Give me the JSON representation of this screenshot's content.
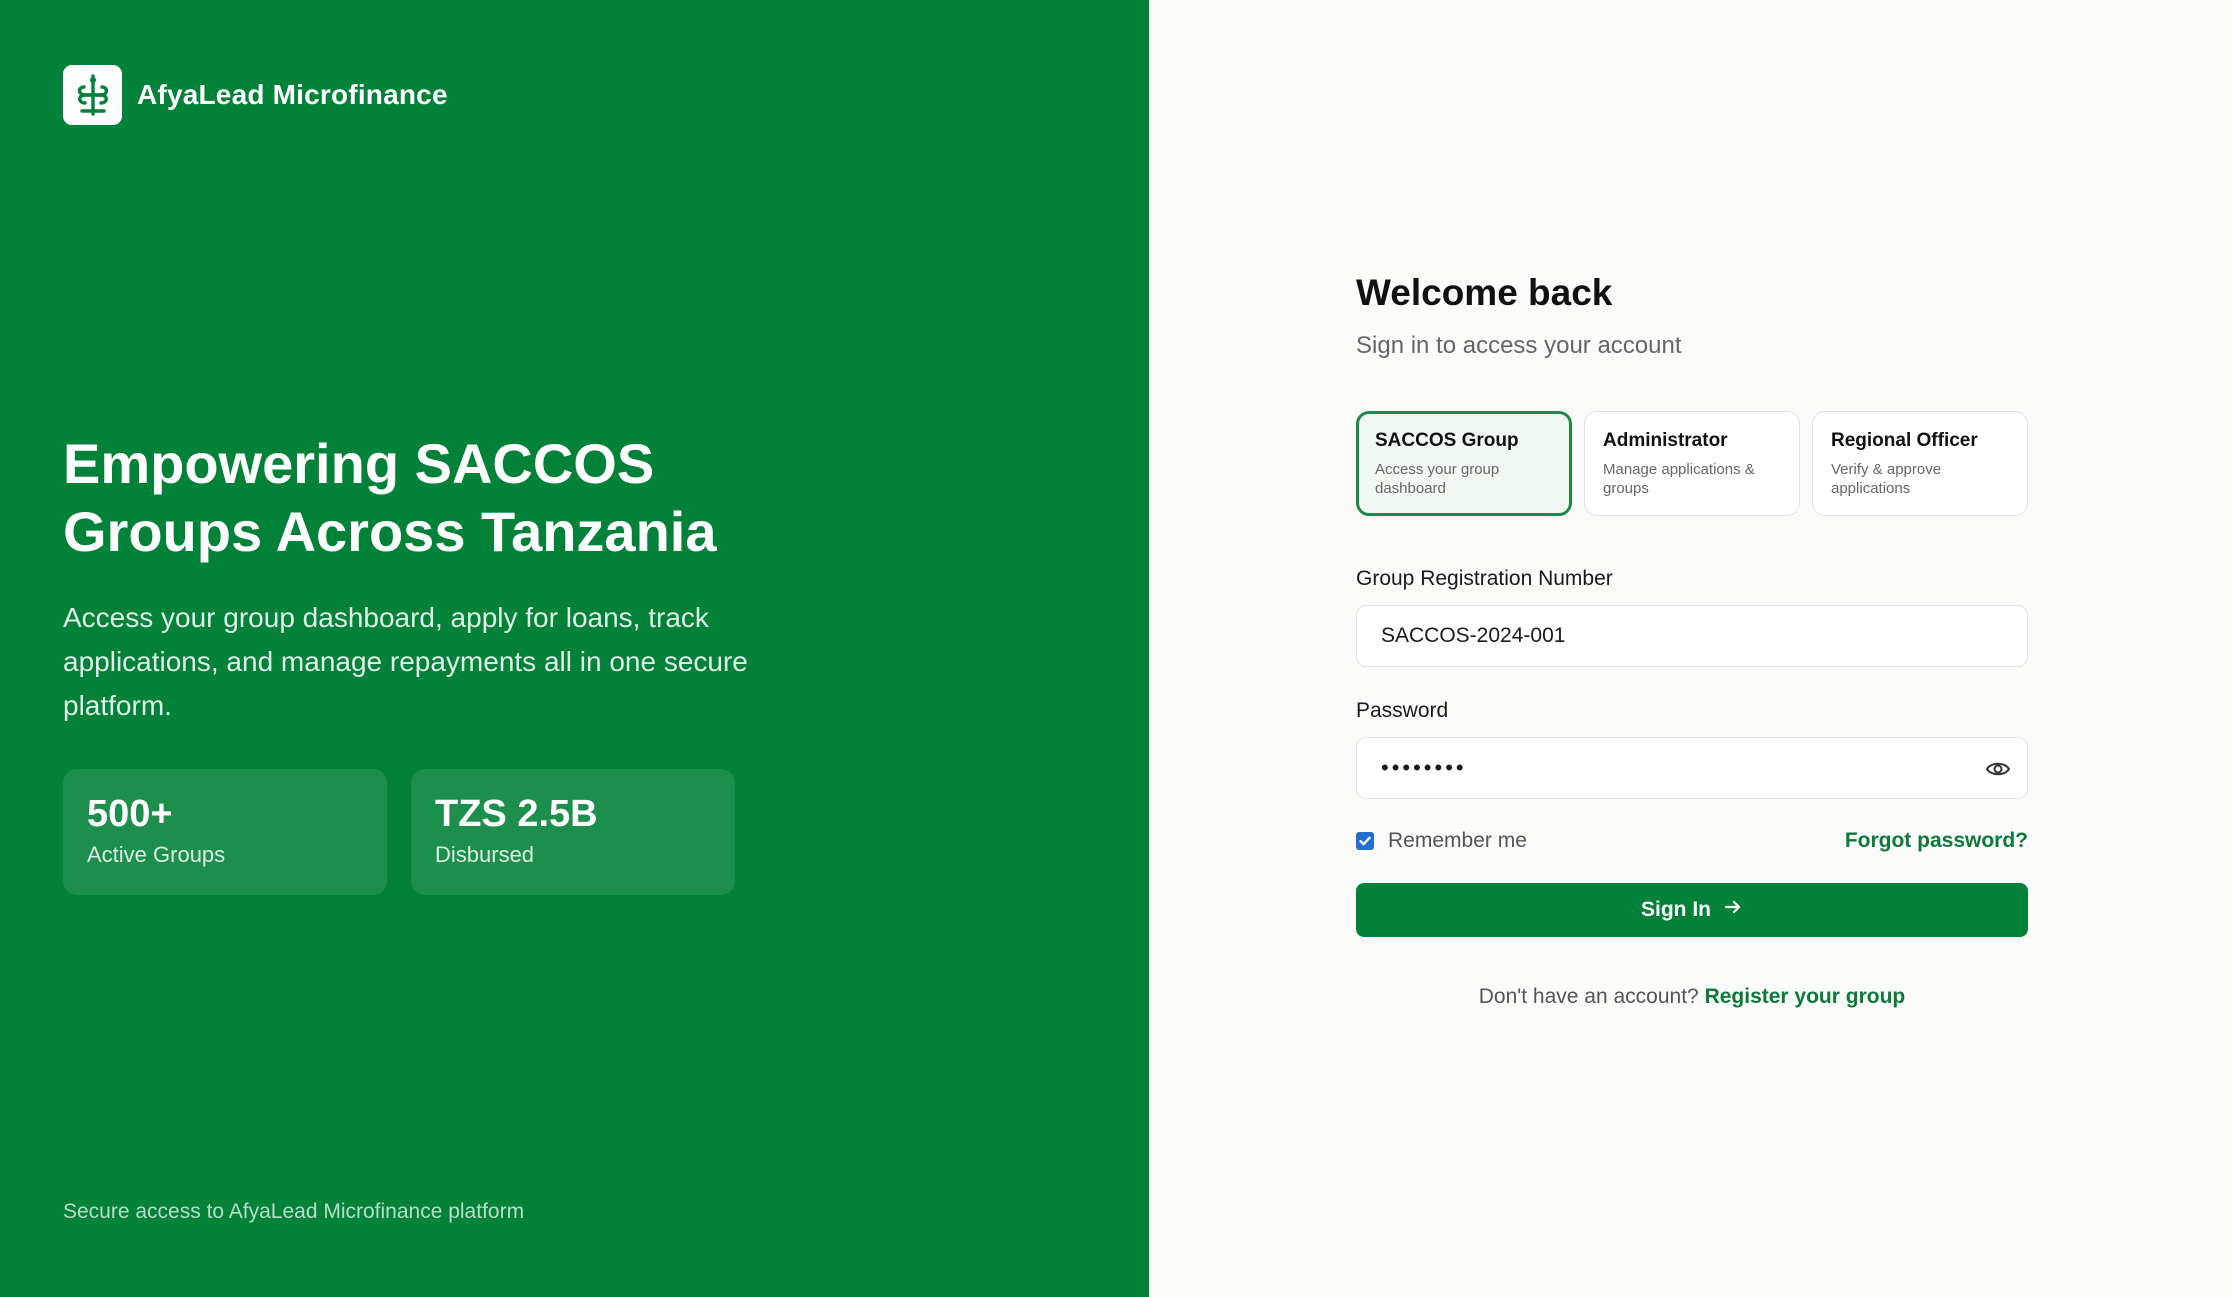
{
  "brand": {
    "name": "AfyaLead Microfinance",
    "logo_icon": "caduceus-icon",
    "accent": "#018238"
  },
  "hero": {
    "title": "Empowering SACCOS Groups Across Tanzania",
    "subtitle": "Access your group dashboard, apply for loans, track applications, and manage repayments all in one secure platform."
  },
  "stats": [
    {
      "value": "500+",
      "label": "Active Groups"
    },
    {
      "value": "TZS 2.5B",
      "label": "Disbursed"
    }
  ],
  "left_footer": "Secure access to AfyaLead Microfinance platform",
  "login": {
    "title": "Welcome back",
    "subtitle": "Sign in to access your account",
    "roles": [
      {
        "title": "SACCOS Group",
        "description": "Access your group dashboard",
        "selected": true
      },
      {
        "title": "Administrator",
        "description": "Manage applications & groups",
        "selected": false
      },
      {
        "title": "Regional Officer",
        "description": "Verify & approve applications",
        "selected": false
      }
    ],
    "registration_label": "Group Registration Number",
    "registration_value": "SACCOS-2024-001",
    "password_label": "Password",
    "password_value": "••••••••",
    "password_icon": "eye-icon",
    "remember_label": "Remember me",
    "remember_checked": true,
    "forgot_label": "Forgot password?",
    "signin_label": "Sign In",
    "signin_icon": "arrow-right-icon",
    "register_prompt": "Don't have an account?",
    "register_link": "Register your group"
  }
}
